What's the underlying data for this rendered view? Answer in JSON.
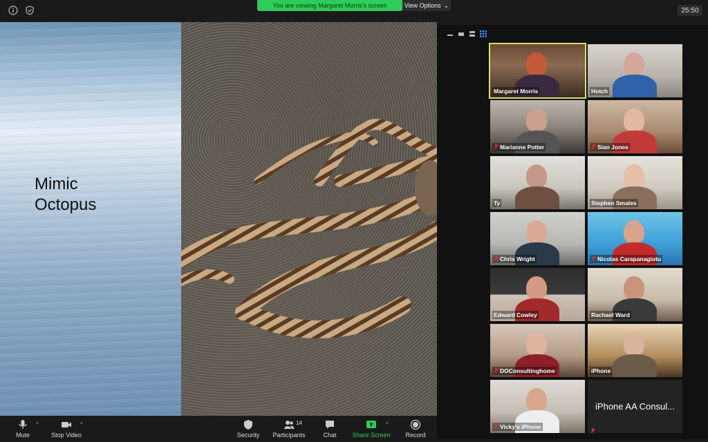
{
  "topbar": {
    "banner": "You are viewing Margaret Morris's screen",
    "view_options": "View Options",
    "view_options_caret": "⌄",
    "timer": "25:50"
  },
  "slide": {
    "title_line1": "Mimic",
    "title_line2": "Octopus"
  },
  "gallery": {
    "participants": [
      {
        "name": "Margaret Morris",
        "muted": false,
        "active": true
      },
      {
        "name": "Hotch",
        "muted": false
      },
      {
        "name": "Marianne Potter",
        "muted": true
      },
      {
        "name": "Sian Jones",
        "muted": true
      },
      {
        "name": "Ty",
        "muted": false
      },
      {
        "name": "Stephen Smales",
        "muted": false
      },
      {
        "name": "Chris Wright",
        "muted": true
      },
      {
        "name": "Nicolas Carapanagiotu",
        "muted": true
      },
      {
        "name": "Edward Cowley",
        "muted": false
      },
      {
        "name": "Rachael Ward",
        "muted": false
      },
      {
        "name": "DOConsultinghome",
        "muted": true
      },
      {
        "name": "iPhone",
        "muted": false
      },
      {
        "name": "Vicky's iPhone",
        "muted": true
      },
      {
        "name": "iPhone AA Consul...",
        "muted": true
      }
    ]
  },
  "bottombar": {
    "mute": "Mute",
    "stop_video": "Stop Video",
    "security": "Security",
    "participants": "Participants",
    "participants_count": "14",
    "chat": "Chat",
    "share_screen": "Share Screen",
    "record": "Record",
    "caret": "^"
  },
  "colors": {
    "share_green": "#2ecc58",
    "active_speaker": "#d7df6e",
    "muted_red": "#e02b2b"
  }
}
